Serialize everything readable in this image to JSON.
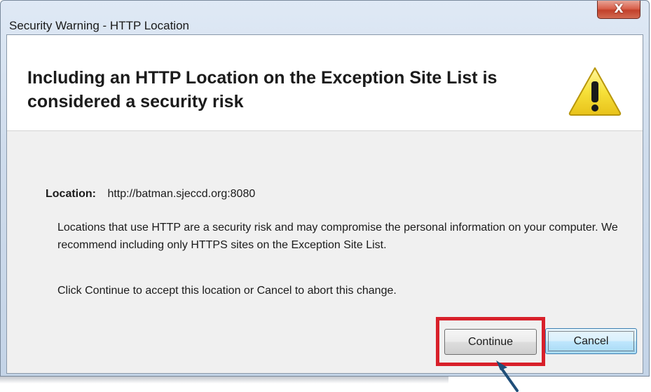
{
  "window": {
    "title": "Security Warning - HTTP Location",
    "close_glyph": "X"
  },
  "header": {
    "heading": "Including an HTTP Location on the Exception Site List is considered a security risk",
    "icon": "warning-icon"
  },
  "location": {
    "label": "Location:",
    "value": "http://batman.sjeccd.org:8080"
  },
  "body": {
    "paragraph1": "Locations that use HTTP are a security risk and may compromise the personal information on your computer.  We recommend including only HTTPS sites on the Exception Site List.",
    "paragraph2": "Click Continue to accept this location or Cancel to abort this change."
  },
  "buttons": {
    "continue_label": "Continue",
    "cancel_label": "Cancel"
  },
  "annotations": {
    "highlight_color": "#d8202a",
    "arrow_color": "#1f4e79"
  },
  "colors": {
    "warning_fill": "#f7e13a",
    "warning_outline": "#b8960c"
  }
}
